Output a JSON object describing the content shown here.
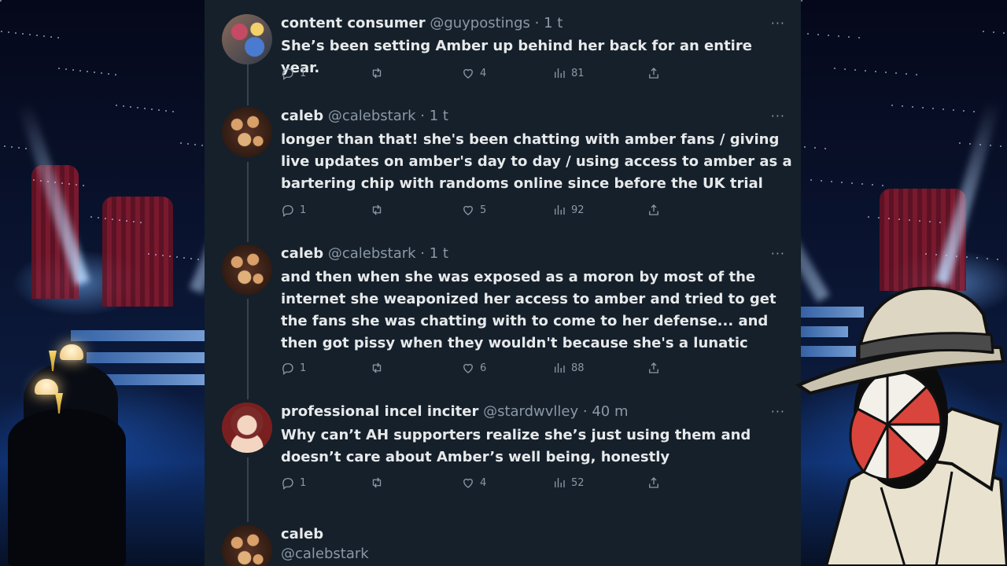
{
  "tweets": [
    {
      "name": "content consumer",
      "handle": "@guypostings",
      "time": "· 1 t",
      "text": "She’s been setting Amber up behind her back for an entire year.",
      "replies": "1",
      "likes": "4",
      "views": "81",
      "avatar": "avatar-collage"
    },
    {
      "name": "caleb",
      "handle": "@calebstark",
      "time": "· 1 t",
      "text": "longer than that! she's been chatting with amber fans / giving live updates on amber's day to day / using access to amber as a bartering chip with randoms online since before the UK trial",
      "replies": "1",
      "likes": "5",
      "views": "92",
      "avatar": "avatar-group-photo"
    },
    {
      "name": "caleb",
      "handle": "@calebstark",
      "time": "· 1 t",
      "text": "and then when she was exposed as a moron by most of the internet she weaponized her access to amber and tried to get the fans she was chatting with to come to her defense... and then got pissy when they wouldn't because she's a lunatic",
      "replies": "1",
      "likes": "6",
      "views": "88",
      "avatar": "avatar-group-photo"
    },
    {
      "name": "professional incel inciter",
      "handle": "@stardwvlley",
      "time": "· 40 m",
      "text": "Why can’t AH supporters realize she’s just using them and doesn’t care about Amber’s well being, honestly",
      "replies": "1",
      "likes": "4",
      "views": "52",
      "avatar": "avatar-illustrated-woman"
    },
    {
      "name": "caleb",
      "handle": "@calebstark",
      "avatar": "avatar-group-photo"
    }
  ],
  "icons": {
    "reply": "reply-icon",
    "retweet": "retweet-icon",
    "like": "like-icon",
    "views": "views-icon",
    "share": "share-icon",
    "more": "more-icon"
  },
  "more_glyph": "···",
  "colors": {
    "feed_bg": "#15202b",
    "text": "#e7e9ea",
    "secondary": "#8b98a5"
  }
}
